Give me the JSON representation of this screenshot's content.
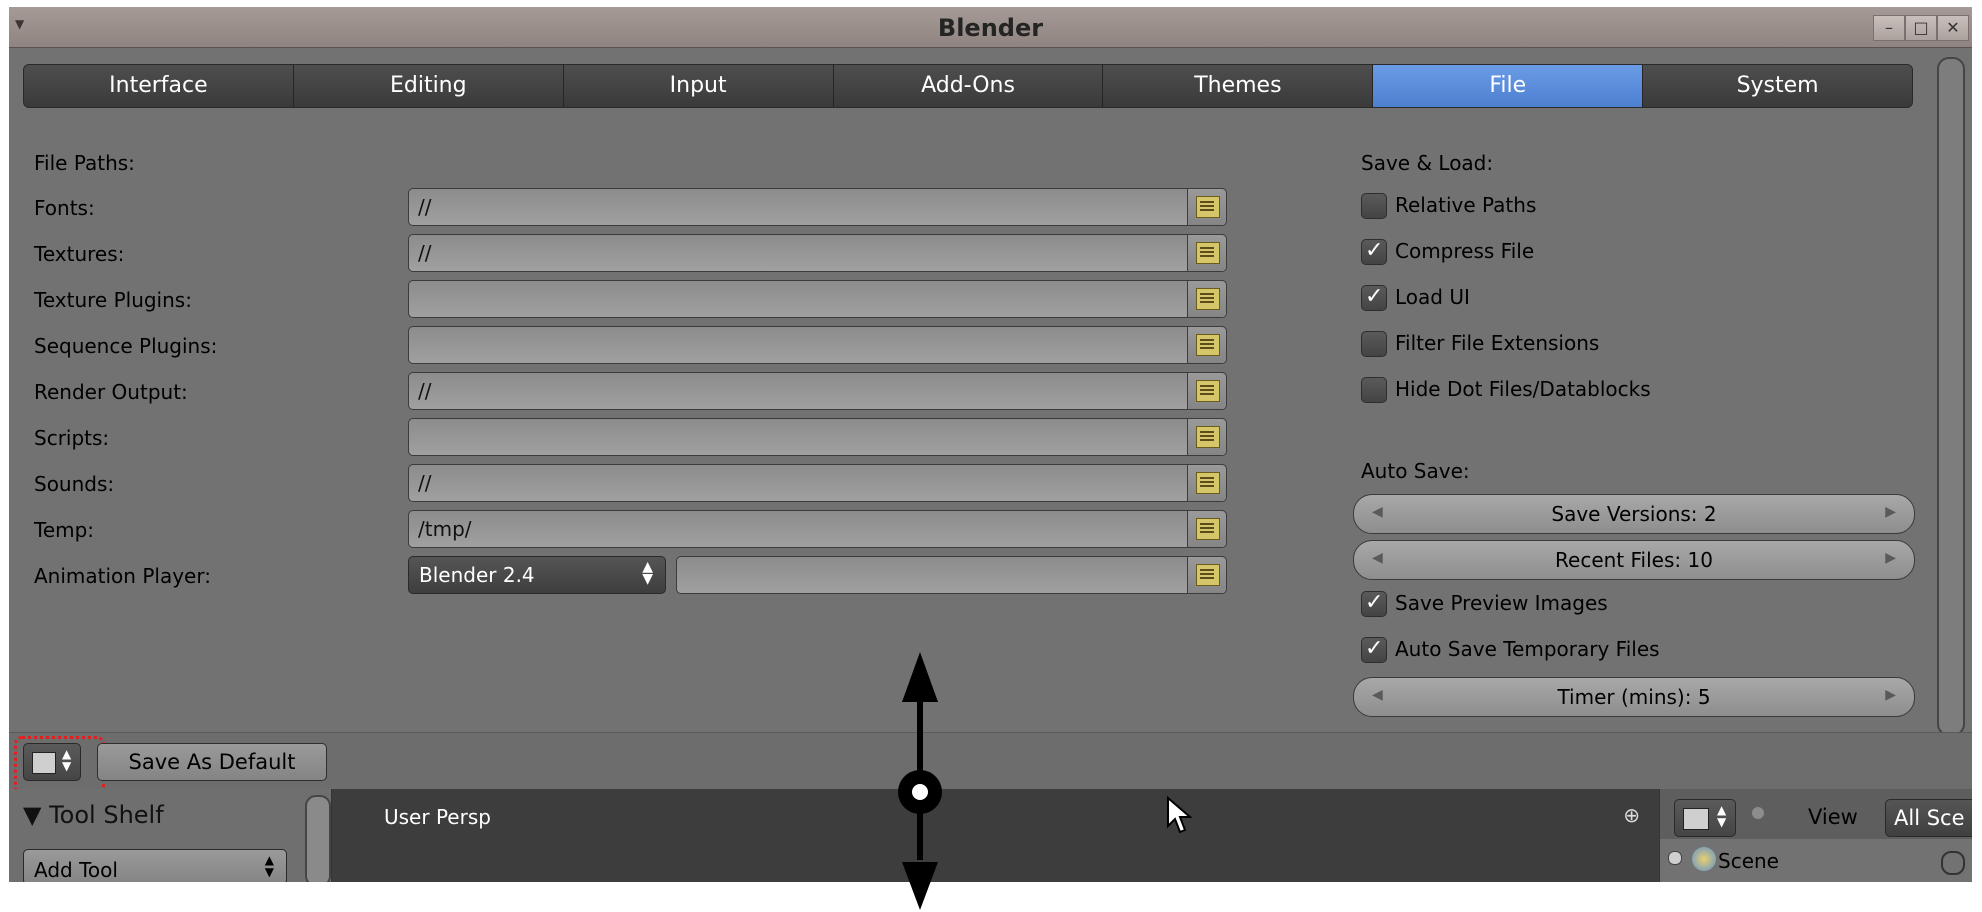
{
  "window": {
    "title": "Blender"
  },
  "tabs": [
    {
      "label": "Interface",
      "active": false
    },
    {
      "label": "Editing",
      "active": false
    },
    {
      "label": "Input",
      "active": false
    },
    {
      "label": "Add-Ons",
      "active": false
    },
    {
      "label": "Themes",
      "active": false
    },
    {
      "label": "File",
      "active": true
    },
    {
      "label": "System",
      "active": false
    }
  ],
  "file_paths": {
    "header": "File Paths:",
    "rows": [
      {
        "label": "Fonts:",
        "value": "//"
      },
      {
        "label": "Textures:",
        "value": "//"
      },
      {
        "label": "Texture Plugins:",
        "value": ""
      },
      {
        "label": "Sequence Plugins:",
        "value": ""
      },
      {
        "label": "Render Output:",
        "value": "//"
      },
      {
        "label": "Scripts:",
        "value": ""
      },
      {
        "label": "Sounds:",
        "value": "//"
      },
      {
        "label": "Temp:",
        "value": "/tmp/"
      }
    ],
    "animation_player": {
      "label": "Animation Player:",
      "selected": "Blender 2.4",
      "value": ""
    }
  },
  "save_load": {
    "header": "Save & Load:",
    "options": [
      {
        "label": "Relative Paths",
        "checked": false
      },
      {
        "label": "Compress File",
        "checked": true
      },
      {
        "label": "Load UI",
        "checked": true
      },
      {
        "label": "Filter File Extensions",
        "checked": false
      },
      {
        "label": "Hide Dot Files/Datablocks",
        "checked": false
      }
    ]
  },
  "auto_save": {
    "header": "Auto Save:",
    "save_versions": "Save Versions: 2",
    "recent_files": "Recent Files: 10",
    "save_preview_images": {
      "label": "Save Preview Images",
      "checked": true
    },
    "auto_save_temp": {
      "label": "Auto Save Temporary Files",
      "checked": true
    },
    "timer": "Timer (mins): 5"
  },
  "bottom_bar": {
    "save_default": "Save As Default"
  },
  "tool_shelf": {
    "header": "Tool Shelf",
    "add_tool": "Add Tool"
  },
  "viewport": {
    "name": "User Persp"
  },
  "outliner": {
    "view": "View",
    "all_scenes": "All Sce",
    "scene": "Scene"
  },
  "colors": {
    "active_tab": "#5a8cdc",
    "background": "#727272",
    "highlight": "#e02020"
  }
}
